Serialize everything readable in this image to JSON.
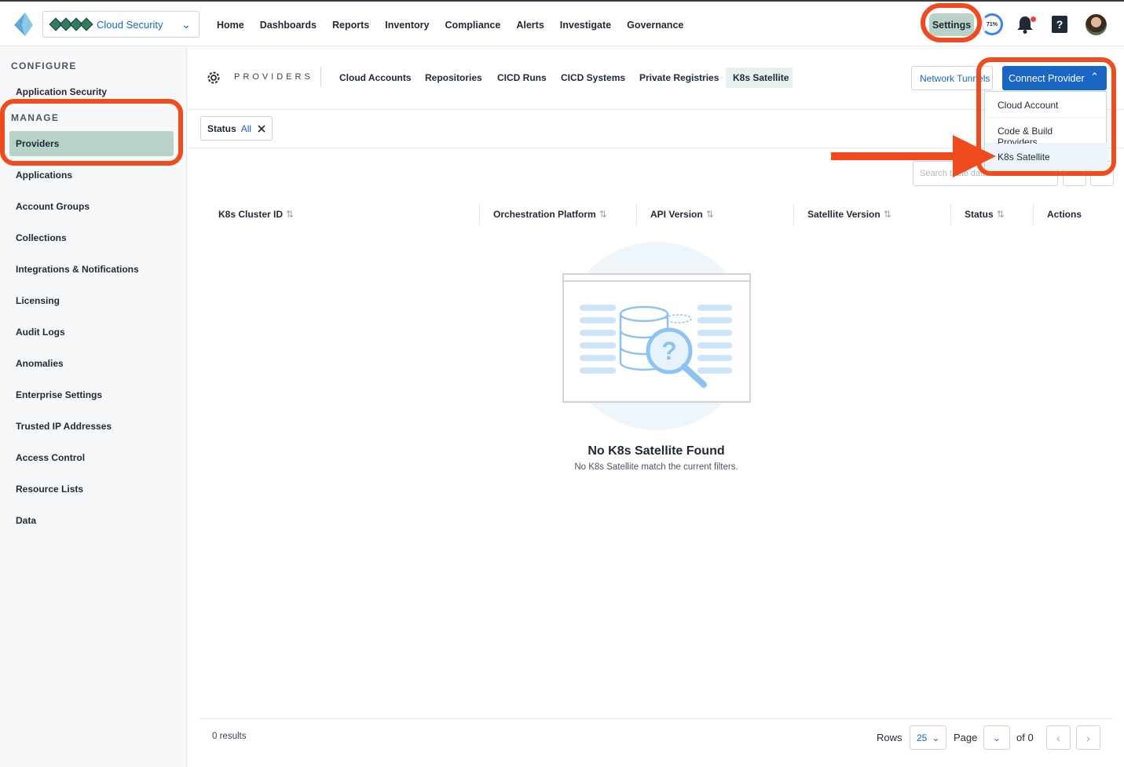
{
  "topbar": {
    "tenant": "Cloud Security",
    "nav": [
      "Home",
      "Dashboards",
      "Reports",
      "Inventory",
      "Compliance",
      "Alerts",
      "Investigate",
      "Governance"
    ],
    "settings": "Settings",
    "gauge": "71%",
    "help": "?"
  },
  "sidebar": {
    "configure_heading": "CONFIGURE",
    "configure_items": [
      "Application Security"
    ],
    "manage_heading": "MANAGE",
    "manage_items": [
      "Providers",
      "Applications",
      "Account Groups",
      "Collections",
      "Integrations & Notifications",
      "Licensing",
      "Audit Logs",
      "Anomalies",
      "Enterprise Settings",
      "Trusted IP Addresses",
      "Access Control",
      "Resource Lists",
      "Data"
    ],
    "active_item": "Providers"
  },
  "subnav": {
    "label": "PROVIDERS",
    "tabs": [
      "Cloud Accounts",
      "Repositories",
      "CICD Runs",
      "CICD Systems",
      "Private Registries",
      "K8s Satellite"
    ],
    "active_tab": "K8s Satellite",
    "network_button": "Network Tunnels",
    "connect_button": "Connect Provider"
  },
  "dropdown": {
    "items": [
      "Cloud Account",
      "Code & Build Providers",
      "K8s Satellite"
    ],
    "highlighted": "K8s Satellite"
  },
  "filter": {
    "key": "Status",
    "value": "All"
  },
  "search": {
    "placeholder": "Search table data"
  },
  "table": {
    "columns": [
      "K8s Cluster ID",
      "Orchestration Platform",
      "API Version",
      "Satellite Version",
      "Status",
      "Actions"
    ]
  },
  "empty": {
    "title": "No K8s Satellite Found",
    "subtitle": "No K8s Satellite match the current filters."
  },
  "footer": {
    "results": "0 results",
    "rows_label": "Rows",
    "rows_value": "25",
    "page_label": "Page",
    "of_label": "of 0"
  },
  "colors": {
    "accent": "#1a66c4",
    "highlight": "#f04b1f",
    "active": "#b9d2c8"
  }
}
